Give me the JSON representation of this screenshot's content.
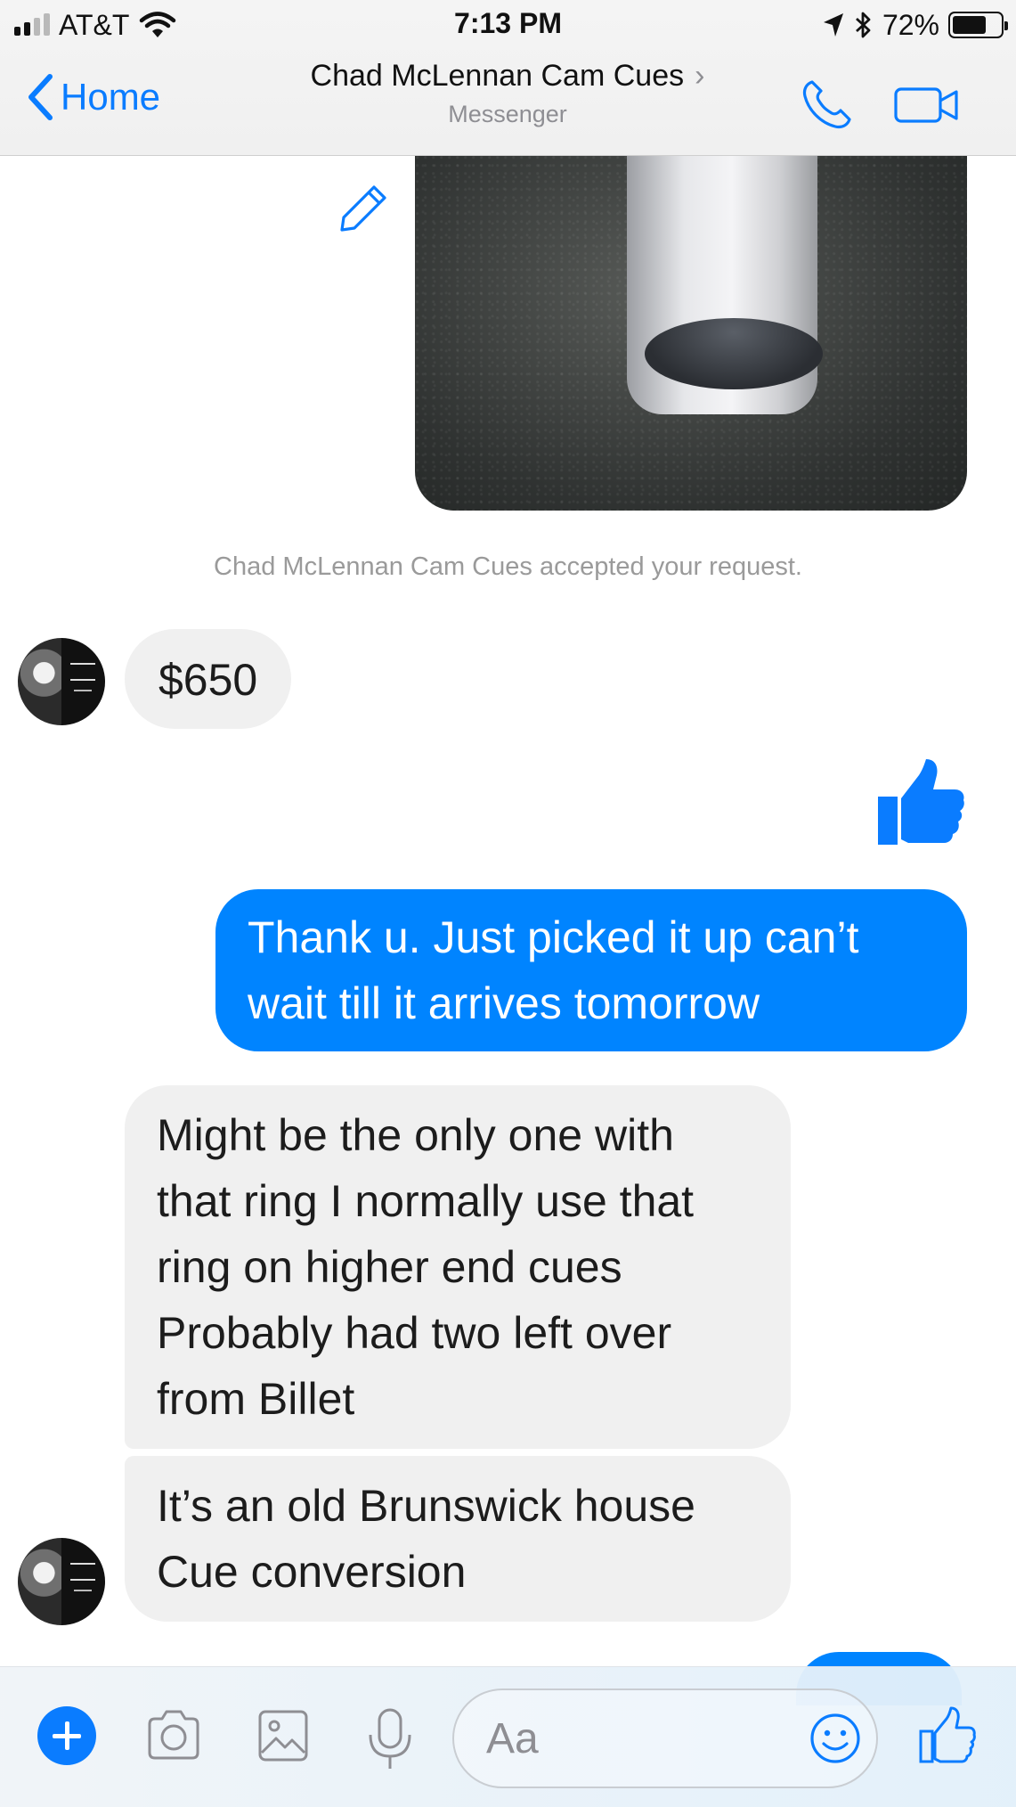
{
  "status_bar": {
    "carrier": "AT&T",
    "time": "7:13 PM",
    "battery_percent": "72%",
    "battery_level": 0.72,
    "icons": [
      "signal-icon",
      "wifi-icon",
      "location-arrow-icon",
      "bluetooth-icon",
      "battery-icon"
    ]
  },
  "nav": {
    "back_label": "Home",
    "title": "Chad McLennan Cam Cues",
    "title_chevron": "›",
    "subtitle": "Messenger",
    "icons": [
      "back-chevron-icon",
      "phone-icon",
      "video-camera-icon"
    ]
  },
  "conversation": {
    "photo": "cue-photo",
    "system_message": "Chad McLennan Cam Cues accepted your request.",
    "messages": [
      {
        "direction": "in",
        "text": "$650"
      },
      {
        "direction": "out",
        "type": "like"
      },
      {
        "direction": "out",
        "text": "Thank u. Just picked it up can’t wait till it arrives tomorrow"
      },
      {
        "direction": "in",
        "text": "Might be the only one with that ring I normally use that ring on higher end cues Probably had two left over from Billet"
      },
      {
        "direction": "in",
        "text": "It’s an old Brunswick house Cue conversion"
      }
    ]
  },
  "composer": {
    "placeholder": "Aa",
    "icons": [
      "plus-icon",
      "camera-icon",
      "image-icon",
      "microphone-icon",
      "emoji-icon",
      "thumbs-up-icon"
    ]
  },
  "colors": {
    "accent": "#0a7cff",
    "outgoing_bubble": "#0084ff",
    "incoming_bubble": "#f0f0f0",
    "system_text": "#9a9a9a"
  }
}
